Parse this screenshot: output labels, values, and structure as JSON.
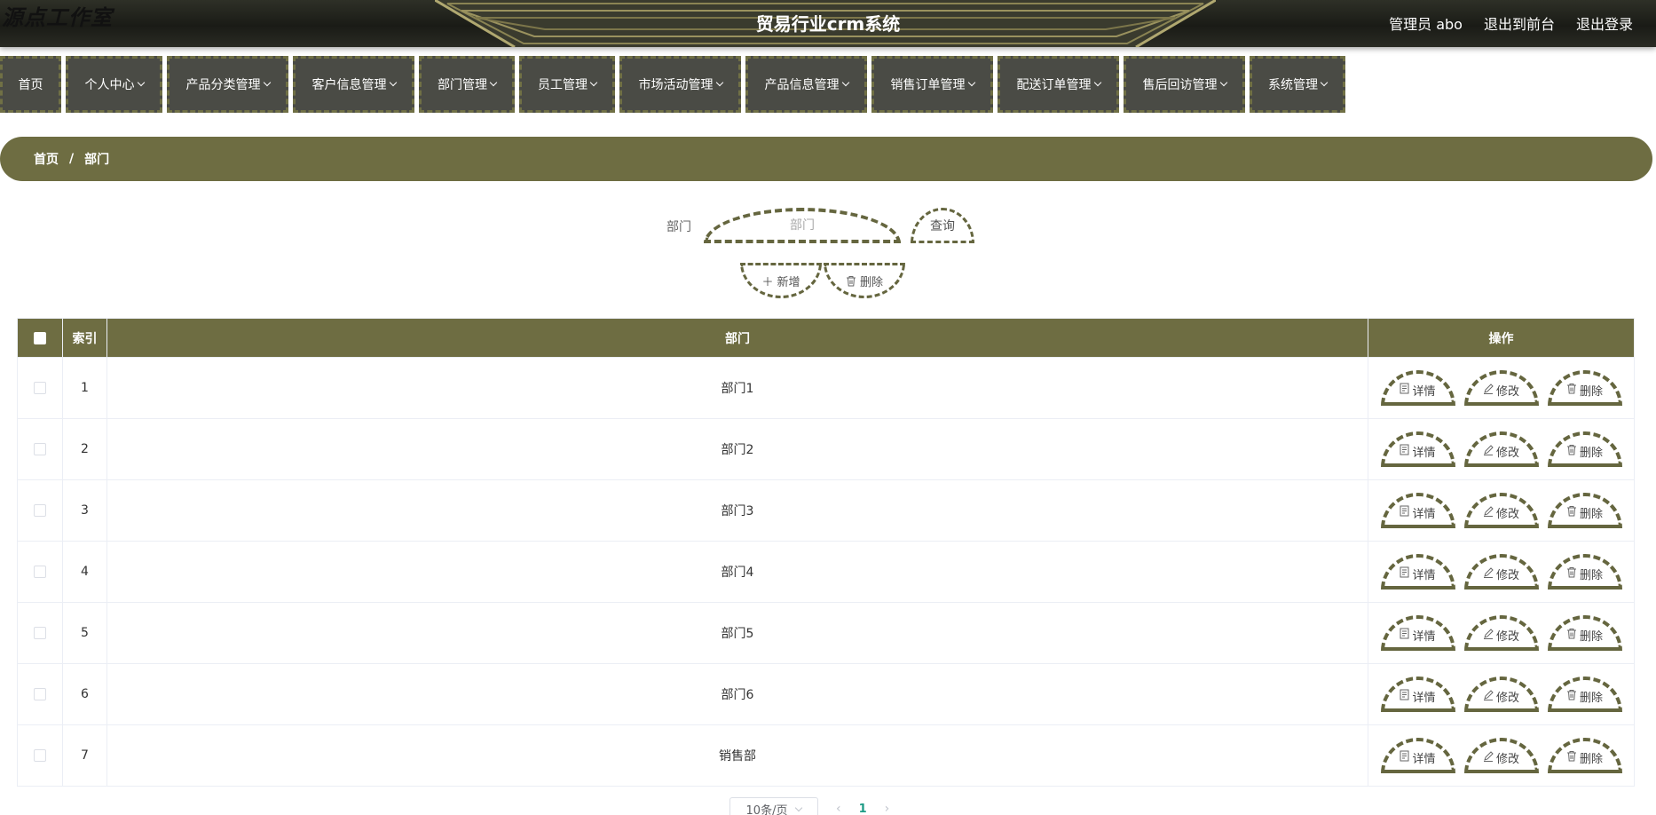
{
  "header": {
    "watermark": "源点工作室",
    "title": "贸易行业crm系统",
    "admin": "管理员 abo",
    "to_front": "退出到前台",
    "logout": "退出登录"
  },
  "nav": {
    "items": [
      {
        "label": "首页",
        "dropdown": false
      },
      {
        "label": "个人中心",
        "dropdown": true
      },
      {
        "label": "产品分类管理",
        "dropdown": true
      },
      {
        "label": "客户信息管理",
        "dropdown": true
      },
      {
        "label": "部门管理",
        "dropdown": true
      },
      {
        "label": "员工管理",
        "dropdown": true
      },
      {
        "label": "市场活动管理",
        "dropdown": true
      },
      {
        "label": "产品信息管理",
        "dropdown": true
      },
      {
        "label": "销售订单管理",
        "dropdown": true
      },
      {
        "label": "配送订单管理",
        "dropdown": true
      },
      {
        "label": "售后回访管理",
        "dropdown": true
      },
      {
        "label": "系统管理",
        "dropdown": true
      }
    ]
  },
  "breadcrumb": {
    "home": "首页",
    "separator": "/",
    "current": "部门"
  },
  "search": {
    "label": "部门",
    "placeholder": "部门",
    "query_label": "查询"
  },
  "actions": {
    "add_label": "新增",
    "batch_delete_label": "删除"
  },
  "table": {
    "columns": {
      "index": "索引",
      "dept": "部门",
      "ops": "操作"
    },
    "rows": [
      {
        "index": "1",
        "dept": "部门1"
      },
      {
        "index": "2",
        "dept": "部门2"
      },
      {
        "index": "3",
        "dept": "部门3"
      },
      {
        "index": "4",
        "dept": "部门4"
      },
      {
        "index": "5",
        "dept": "部门5"
      },
      {
        "index": "6",
        "dept": "部门6"
      },
      {
        "index": "7",
        "dept": "销售部"
      }
    ],
    "op_labels": {
      "detail": "详情",
      "edit": "修改",
      "delete": "删除"
    }
  },
  "pagination": {
    "page_size": "10条/页",
    "current_page": "1"
  },
  "colors": {
    "accent": "#6e6d42",
    "header_bg": "#1f201b",
    "nav_bg": "#4a4b45",
    "page_active": "#1d9b85"
  },
  "icons": {
    "add": "plus-icon",
    "delete": "trash-icon",
    "detail": "document-icon",
    "edit": "pencil-icon"
  }
}
